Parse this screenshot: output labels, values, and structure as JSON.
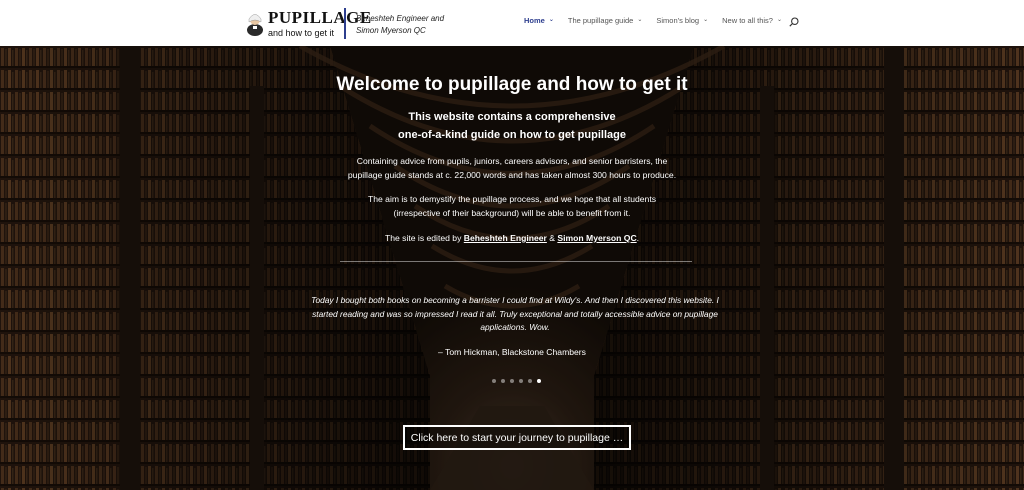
{
  "header": {
    "logo_title": "PUPILLAGE",
    "logo_subtitle": "and how to get it",
    "editors_line1": "Beheshteh Engineer and",
    "editors_line2": "Simon Myerson QC",
    "nav": [
      {
        "label": "Home",
        "active": true
      },
      {
        "label": "The pupillage guide",
        "active": false
      },
      {
        "label": "Simon's blog",
        "active": false
      },
      {
        "label": "New to all this?",
        "active": false
      }
    ],
    "search_icon": "search-icon",
    "accent_color": "#2d3e8e"
  },
  "hero": {
    "title": "Welcome to pupillage and how to get it",
    "subtitle_line1": "This website contains a comprehensive",
    "subtitle_line2": "one-of-a-kind guide on how to get pupillage",
    "para1_line1": "Containing advice from pupils, juniors, careers advisors, and senior barristers, the",
    "para1_line2": "pupillage guide stands at c. 22,000 words and has taken almost 300 hours to produce.",
    "para2_line1": "The aim is to demystify the pupillage process, and we hope that all students",
    "para2_line2": "(irrespective of their background) will be able to benefit from it.",
    "editors_prefix": "The site is edited by ",
    "editor1": "Beheshteh Engineer",
    "editors_and": " & ",
    "editor2": "Simon Myerson QC",
    "editors_suffix": ".",
    "quote_line1": "Today I bought both books on becoming a barrister I could find at Wildy's. And then I discovered this website. I",
    "quote_line2": "started reading and was so impressed I read it all. Truly exceptional and totally accessible advice on pupillage",
    "quote_line3": "applications. Wow.",
    "quote_author": "– Tom Hickman, Blackstone Chambers",
    "slider_count": 6,
    "slider_active_index": 5,
    "cta_label": "Click here to start your journey to pupillage …"
  }
}
